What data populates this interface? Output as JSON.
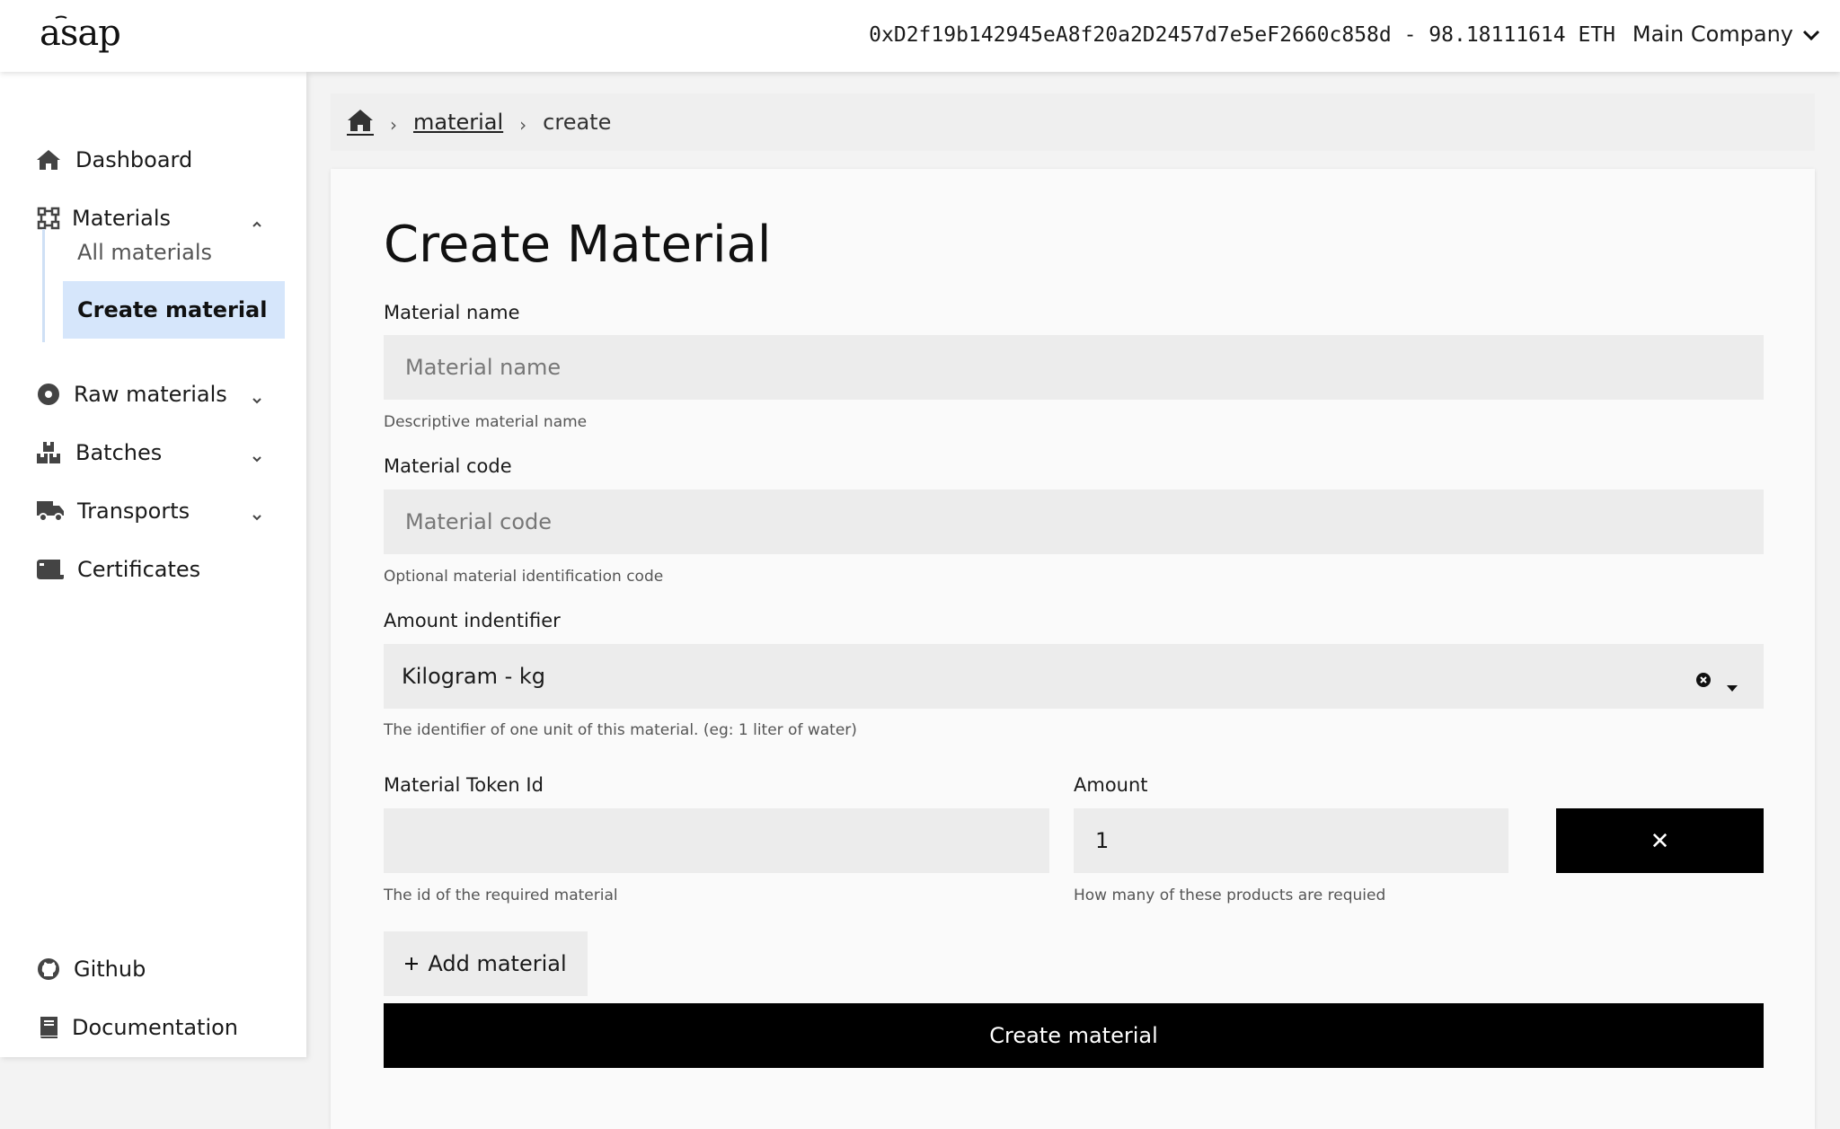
{
  "header": {
    "logo_text": "asap",
    "wallet": "0xD2f19b142945eA8f20a2D2457d7e5eF2660c858d - 98.18111614 ETH",
    "company": "Main Company"
  },
  "sidebar": {
    "items": [
      {
        "label": "Dashboard",
        "icon": "home-icon"
      },
      {
        "label": "Materials",
        "icon": "materials-icon"
      },
      {
        "label": "Raw materials",
        "icon": "raw-materials-icon"
      },
      {
        "label": "Batches",
        "icon": "batches-icon"
      },
      {
        "label": "Transports",
        "icon": "truck-icon"
      },
      {
        "label": "Certificates",
        "icon": "certificate-icon"
      }
    ],
    "materials_sub": [
      {
        "label": "All materials"
      },
      {
        "label": "Create material",
        "active": true
      }
    ],
    "footer": [
      {
        "label": "Github",
        "icon": "github-icon"
      },
      {
        "label": "Documentation",
        "icon": "book-icon"
      }
    ]
  },
  "breadcrumb": {
    "home_icon": "home-icon",
    "items": [
      "material",
      "create"
    ]
  },
  "form": {
    "title": "Create Material",
    "name": {
      "label": "Material name",
      "placeholder": "Material name",
      "value": "",
      "help": "Descriptive material name"
    },
    "code": {
      "label": "Material code",
      "placeholder": "Material code",
      "value": "",
      "help": "Optional material identification code"
    },
    "amount_identifier": {
      "label": "Amount indentifier",
      "value": "Kilogram - kg",
      "help": "The identifier of one unit of this material. (eg: 1 liter of water)"
    },
    "token": {
      "label": "Material Token Id",
      "value": "",
      "help": "The id of the required material"
    },
    "amount": {
      "label": "Amount",
      "value": "1",
      "help": "How many of these products are requied"
    },
    "remove_label": "✕",
    "add_label": "Add material",
    "submit_label": "Create material"
  }
}
